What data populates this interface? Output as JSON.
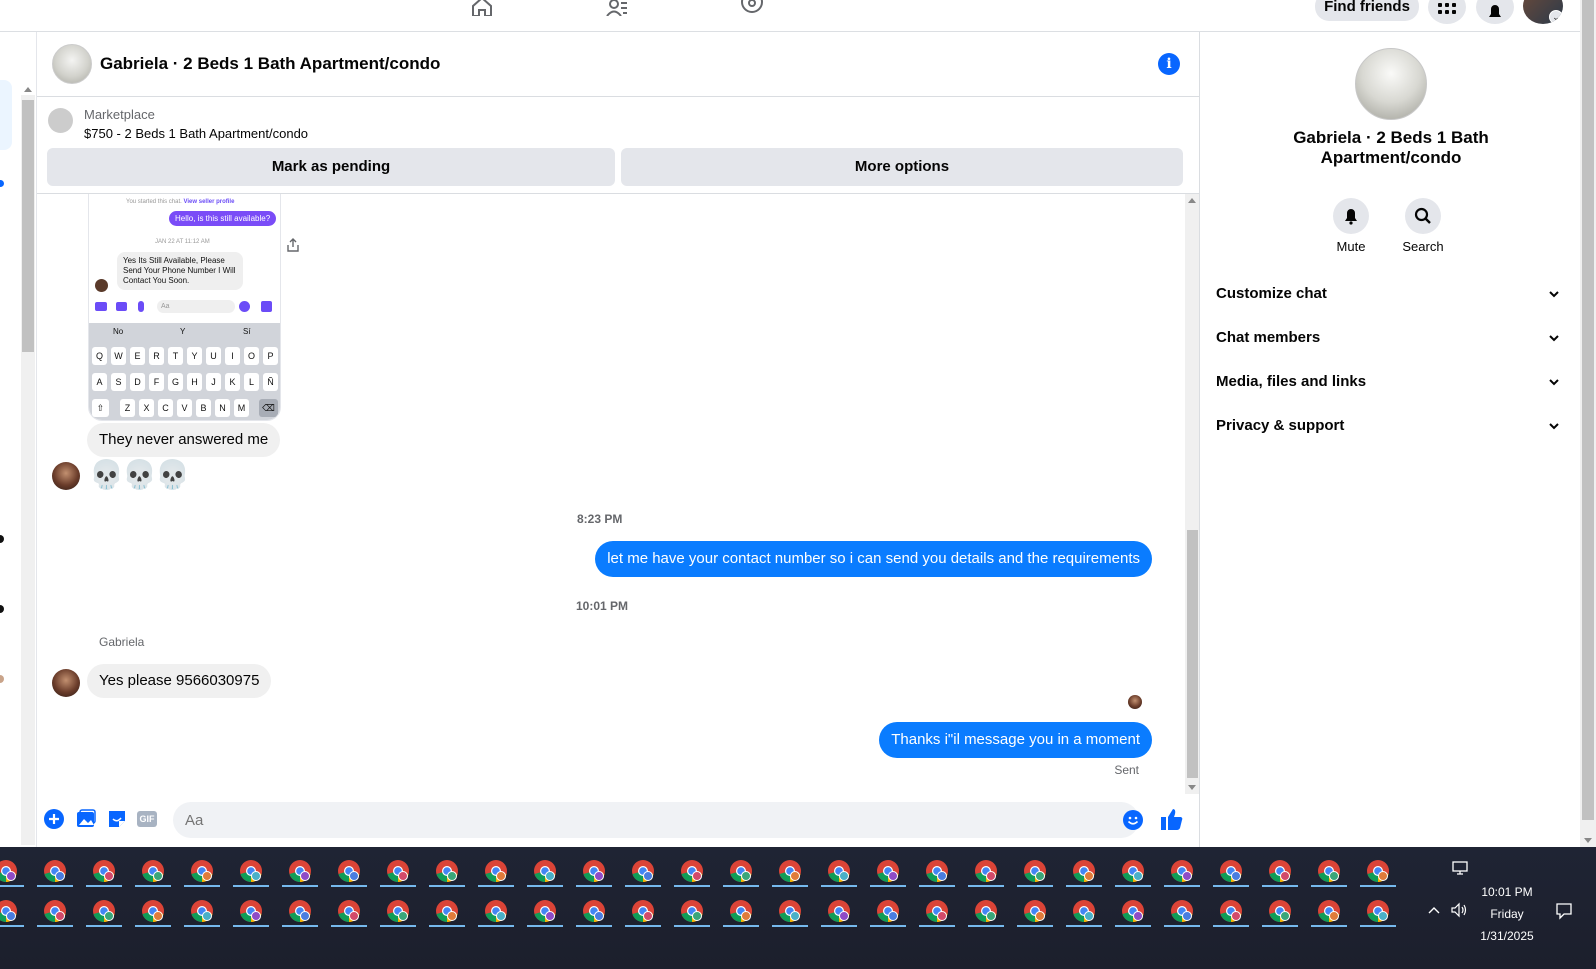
{
  "topbar": {
    "find_friends_label": "Find friends"
  },
  "chat": {
    "title": "Gabriela · 2 Beds 1 Bath Apartment/condo"
  },
  "listing": {
    "source_label": "Marketplace",
    "title": "$750 - 2 Beds 1 Bath Apartment/condo",
    "mark_pending_label": "Mark as pending",
    "more_options_label": "More options"
  },
  "screenshot": {
    "started_text": "You started this chat.",
    "view_profile_text": "View seller profile",
    "outgoing_text": "Hello, is this still available?",
    "date_text": "JAN 22 AT 11:12 AM",
    "incoming_text": "Yes Its Still Available, Please Send Your Phone Number I Will Contact You Soon.",
    "input_placeholder": "Aa",
    "suggestions": [
      "No",
      "Y",
      "Sí"
    ],
    "row1": [
      "Q",
      "W",
      "E",
      "R",
      "T",
      "Y",
      "U",
      "I",
      "O",
      "P"
    ],
    "row2": [
      "A",
      "S",
      "D",
      "F",
      "G",
      "H",
      "J",
      "K",
      "L",
      "Ñ"
    ],
    "row3": [
      "Z",
      "X",
      "C",
      "V",
      "B",
      "N",
      "M"
    ]
  },
  "messages": {
    "never_answered": "They never answered me",
    "skulls": [
      "💀",
      "💀",
      "💀"
    ],
    "time1": "8:23 PM",
    "contact_request": "let me have your contact number so i can send you details and the requirements",
    "time2": "10:01 PM",
    "sender_name": "Gabriela",
    "reply": "Yes please 9566030975",
    "thanks": "Thanks i\"il message you in a moment",
    "status": "Sent"
  },
  "composer": {
    "placeholder": "Aa",
    "gif_label": "GIF"
  },
  "panel": {
    "title": "Gabriela · 2 Beds 1 Bath Apartment/condo",
    "mute_label": "Mute",
    "search_label": "Search",
    "rows": [
      "Customize chat",
      "Chat members",
      "Media, files and links",
      "Privacy & support"
    ]
  },
  "taskbar": {
    "time": "10:01 PM",
    "day": "Friday",
    "date": "1/31/2025"
  },
  "colors": {
    "accent": "#0866ff",
    "outgoing_bubble": "#0a7cff",
    "incoming_bubble": "#f0f0f0",
    "taskbar": "#1f2434"
  }
}
